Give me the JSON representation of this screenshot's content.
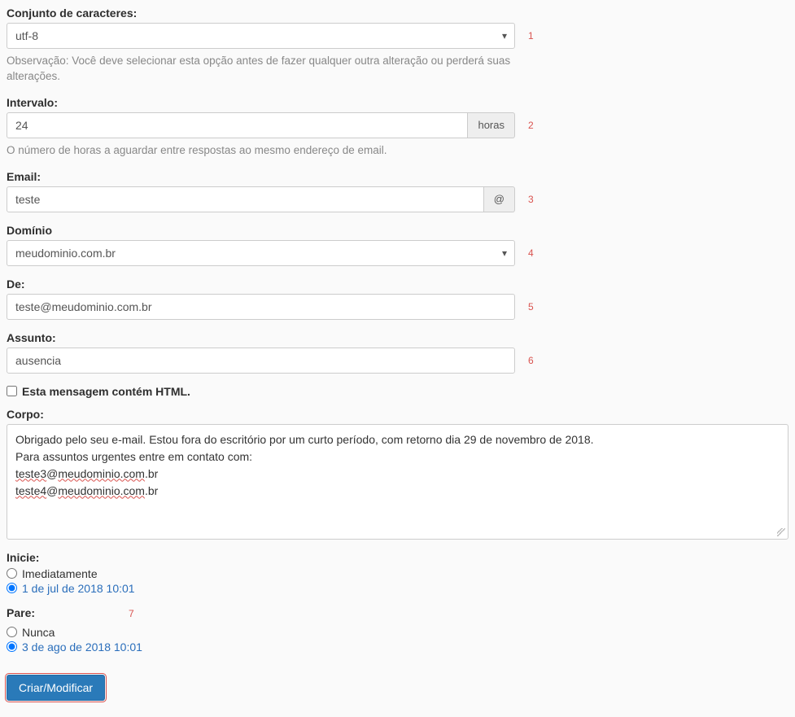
{
  "charset": {
    "label": "Conjunto de caracteres:",
    "value": "utf-8",
    "help": "Observação: Você deve selecionar esta opção antes de fazer qualquer outra alteração ou perderá suas alterações.",
    "note": "1"
  },
  "interval": {
    "label": "Intervalo:",
    "value": "24",
    "addon": "horas",
    "help": "O número de horas a aguardar entre respostas ao mesmo endereço de email.",
    "note": "2"
  },
  "email": {
    "label": "Email:",
    "value": "teste",
    "addon": "@",
    "note": "3"
  },
  "domain": {
    "label": "Domínio",
    "value": "meudominio.com.br",
    "note": "4"
  },
  "from": {
    "label": "De:",
    "value": "teste@meudominio.com.br",
    "note": "5"
  },
  "subject": {
    "label": "Assunto:",
    "value": "ausencia",
    "note": "6"
  },
  "html_checkbox": {
    "label": "Esta mensagem contém HTML."
  },
  "body": {
    "label": "Corpo:",
    "line1": "Obrigado pelo seu e-mail. Estou fora do escritório por um curto período, com retorno dia 29 de novembro de 2018.",
    "line2": "Para assuntos urgentes entre em contato com:",
    "line3_pre": "teste3",
    "line3_mid": "@",
    "line3_domain": "meudominio.com",
    "line3_suf": ".br",
    "line4_pre": "teste4",
    "line4_mid": "@",
    "line4_domain": "meudominio.com",
    "line4_suf": ".br"
  },
  "start": {
    "label": "Inicie:",
    "opt1": "Imediatamente",
    "opt2": "1 de jul de 2018 10:01"
  },
  "stop": {
    "label": "Pare:",
    "note": "7",
    "opt1": "Nunca",
    "opt2": "3 de ago de 2018 10:01"
  },
  "submit": {
    "label": "Criar/Modificar"
  }
}
